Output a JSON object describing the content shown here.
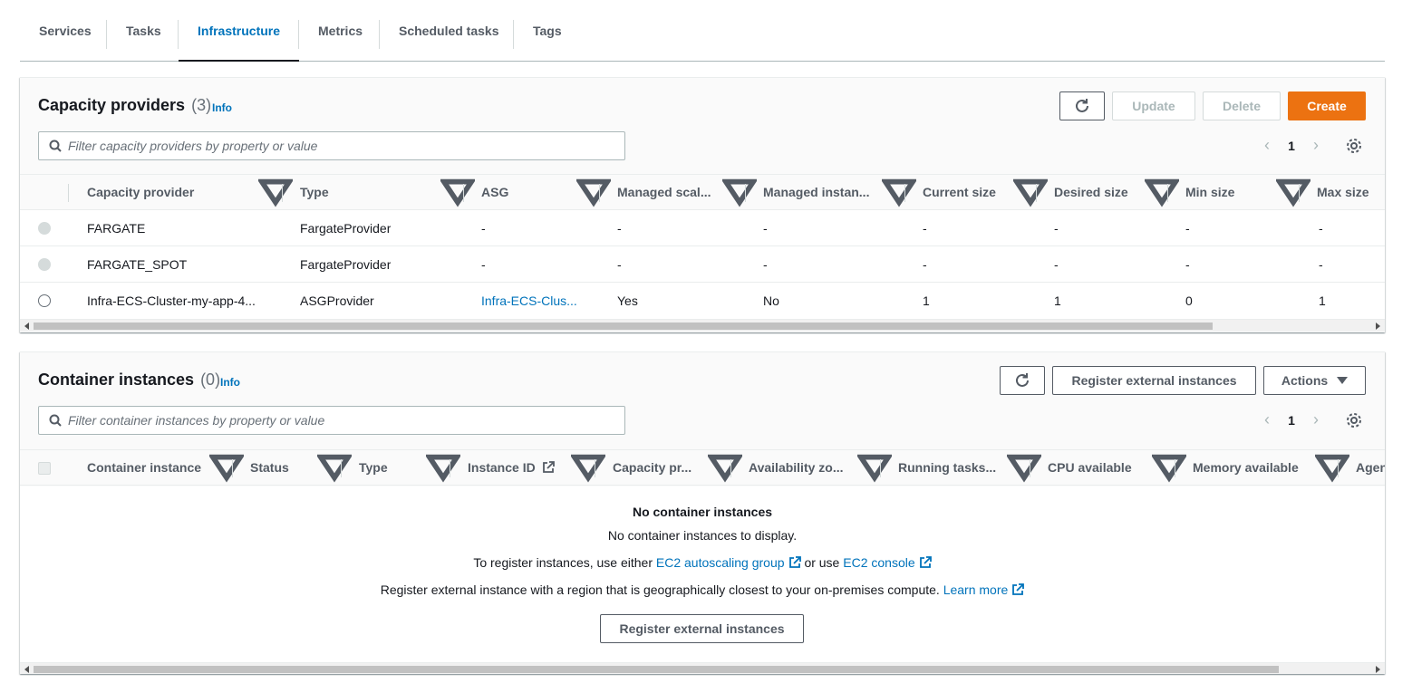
{
  "tabs": [
    {
      "label": "Services",
      "active": false
    },
    {
      "label": "Tasks",
      "active": false
    },
    {
      "label": "Infrastructure",
      "active": true
    },
    {
      "label": "Metrics",
      "active": false
    },
    {
      "label": "Scheduled tasks",
      "active": false
    },
    {
      "label": "Tags",
      "active": false
    }
  ],
  "capacity": {
    "title": "Capacity providers",
    "count": "(3)",
    "info": "Info",
    "buttons": {
      "refresh_icon": "refresh-icon",
      "update": "Update",
      "delete": "Delete",
      "create": "Create"
    },
    "filter_placeholder": "Filter capacity providers by property or value",
    "page": "1",
    "columns": [
      "Capacity provider",
      "Type",
      "ASG",
      "Managed scal...",
      "Managed instan...",
      "Current size",
      "Desired size",
      "Min size",
      "Max size"
    ],
    "rows": [
      {
        "selectable": false,
        "cells": [
          "FARGATE",
          "FargateProvider",
          "-",
          "-",
          "-",
          "-",
          "-",
          "-",
          "-"
        ]
      },
      {
        "selectable": false,
        "cells": [
          "FARGATE_SPOT",
          "FargateProvider",
          "-",
          "-",
          "-",
          "-",
          "-",
          "-",
          "-"
        ]
      },
      {
        "selectable": true,
        "cells": [
          "Infra-ECS-Cluster-my-app-4...",
          "ASGProvider",
          "Infra-ECS-Clus...",
          "Yes",
          "No",
          "1",
          "1",
          "0",
          "1"
        ]
      }
    ]
  },
  "instances": {
    "title": "Container instances",
    "count": "(0)",
    "info": "Info",
    "buttons": {
      "refresh_icon": "refresh-icon",
      "register": "Register external instances",
      "actions": "Actions"
    },
    "filter_placeholder": "Filter container instances by property or value",
    "page": "1",
    "columns": [
      "Container instance",
      "Status",
      "Type",
      "Instance ID",
      "Capacity pr...",
      "Availability zo...",
      "Running tasks...",
      "CPU available",
      "Memory available",
      "Agen"
    ],
    "empty": {
      "title": "No container instances",
      "subtitle": "No container instances to display.",
      "line1_prefix": "To register instances, use either",
      "line1_link1": "EC2 autoscaling group",
      "line1_mid": "or use",
      "line1_link2": "EC2 console",
      "line2_prefix": "Register external instance with a region that is geographically closest to your on-premises compute.",
      "line2_link": "Learn more",
      "button": "Register external instances"
    }
  },
  "colors": {
    "accent": "#0073bb",
    "primary_button": "#ec7211"
  }
}
